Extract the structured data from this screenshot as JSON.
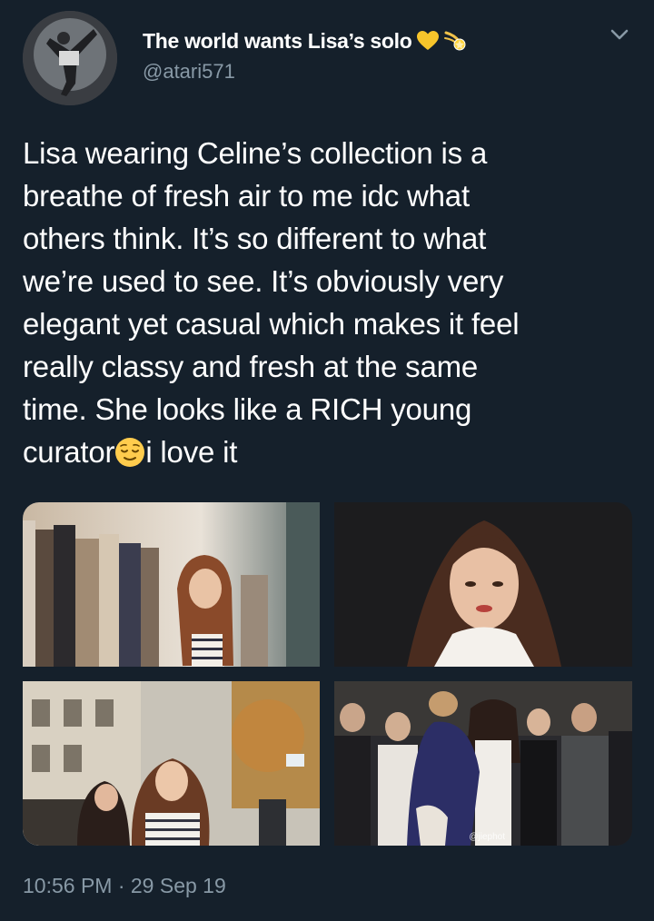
{
  "author": {
    "display_name": "The world wants Lisa’s solo",
    "handle": "@atari571",
    "name_emojis": [
      "yellow-heart-emoji",
      "comet-emoji"
    ]
  },
  "tweet": {
    "lines": [
      "Lisa wearing Celine’s collection is a",
      "breathe of fresh air to me idc what",
      "others think. It’s so different to what",
      "we’re used to see. It’s obviously very",
      "elegant yet casual which makes it feel",
      "really classy and fresh at the same",
      "time. She looks like a RICH young"
    ],
    "last_line_before_emoji": "curator",
    "last_line_after_emoji": "i love it",
    "inline_emoji": "relieved-face-emoji"
  },
  "media": {
    "count": 4,
    "watermark": "@jiephot"
  },
  "meta": {
    "timestamp": "10:56 PM · 29 Sep 19"
  },
  "colors": {
    "background": "#15202b",
    "text": "#ffffff",
    "secondary": "#8899a6"
  }
}
